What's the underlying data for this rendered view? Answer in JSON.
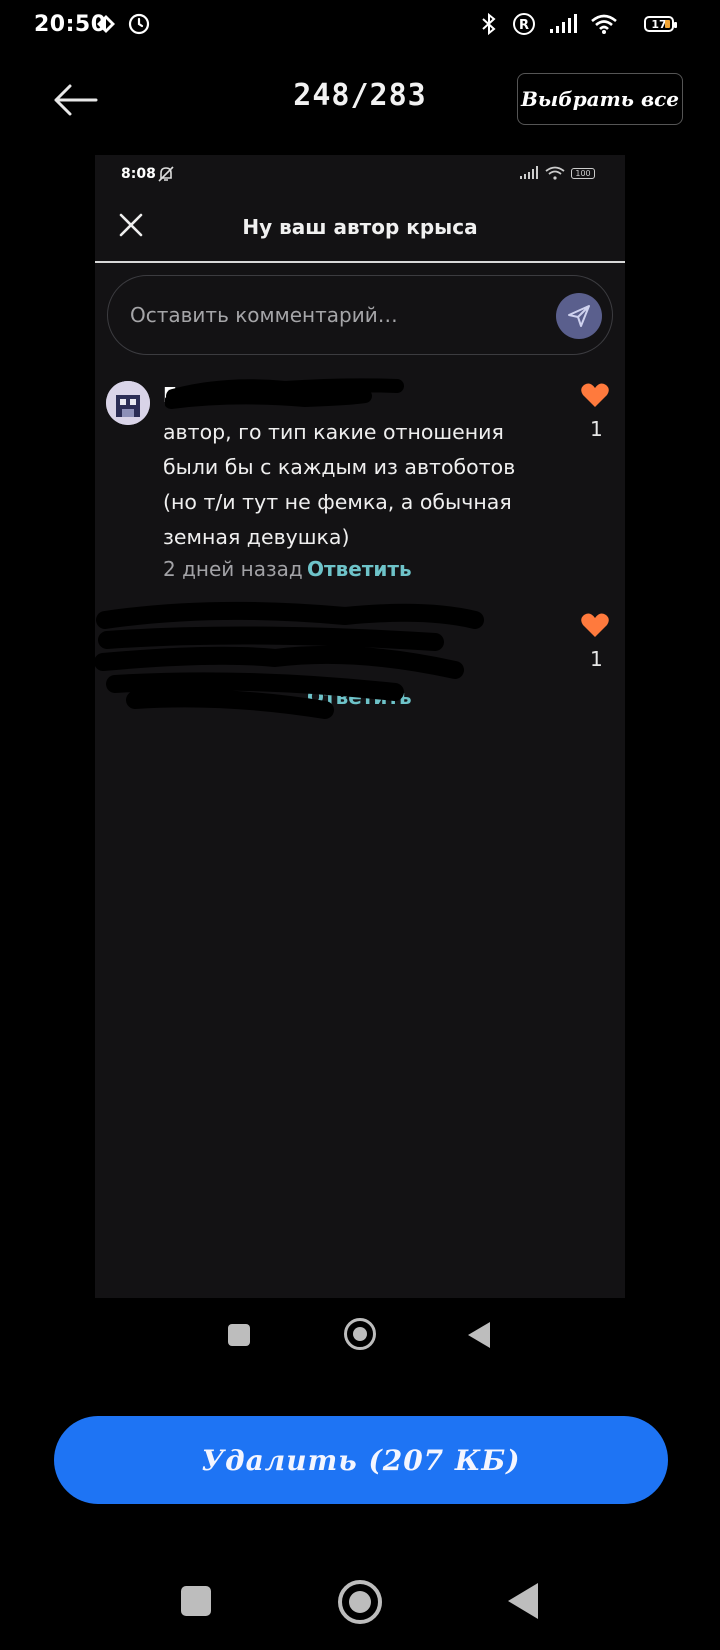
{
  "status_bar": {
    "time": "20:50",
    "battery": "17",
    "icons": [
      "data-saver-icon",
      "alarm-icon",
      "bluetooth-icon",
      "roaming-icon",
      "signal-icon",
      "wifi-icon",
      "battery-icon"
    ]
  },
  "top_bar": {
    "counter": "248/283",
    "select_all_label": "Выбрать все"
  },
  "screenshot": {
    "status_time": "8:08",
    "battery": "100",
    "title": "Ну ваш автор крыса",
    "comment_input": {
      "placeholder": "Оставить комментарий…"
    },
    "comments": [
      {
        "author": "Г",
        "text": "автор, го тип какие отношения были бы с каждым из автоботов (но т/и тут не фемка, а обычная земная девушка)",
        "time": "2 дней назад",
        "reply_label": "Ответить",
        "likes": "1"
      },
      {
        "reply_label": "Ответить",
        "likes": "1"
      }
    ]
  },
  "actions": {
    "delete_label": "Удалить (207 КБ)"
  },
  "colors": {
    "accent": "#1e74f4",
    "heart": "#ff7a3d",
    "reply": "#6ec3c9",
    "send": "#5a5f8d"
  }
}
